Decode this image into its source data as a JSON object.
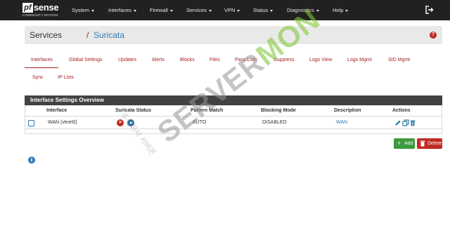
{
  "navbar": {
    "brand": {
      "pf": "pf",
      "sense": "sense",
      "edition": "COMMUNITY EDITION"
    },
    "items": [
      "System",
      "Interfaces",
      "Firewall",
      "Services",
      "VPN",
      "Status",
      "Diagnostics",
      "Help"
    ],
    "logout_icon": "sign-out-icon"
  },
  "breadcrumb": {
    "parent": "Services",
    "separator": "/",
    "current": "Suricata",
    "help_label": "?"
  },
  "tabs": [
    "Interfaces",
    "Global Settings",
    "Updates",
    "Alerts",
    "Blocks",
    "Files",
    "Pass Lists",
    "Suppress",
    "Logs View",
    "Logs Mgmt",
    "SID Mgmt",
    "Sync",
    "IP Lists"
  ],
  "active_tab": "Interfaces",
  "panel": {
    "title": "Interface Settings Overview",
    "columns": [
      "Interface",
      "Suricata Status",
      "Pattern Match",
      "Blocking Mode",
      "Description",
      "Actions"
    ],
    "rows": [
      {
        "interface": "WAN (vtnet0)",
        "pattern_match": "AUTO",
        "blocking_mode": "DISABLED",
        "description": "WAN",
        "status_icons": [
          "stopped-icon",
          "start-icon"
        ],
        "action_icons": [
          "edit-icon",
          "copy-icon",
          "delete-icon"
        ]
      }
    ]
  },
  "buttons": {
    "add": "Add",
    "delete": "Delete"
  },
  "info_label": "i",
  "watermark": {
    "text_gray": "SERVER",
    "text_green": "MON",
    "side_text": "주식회사 서버몬"
  },
  "colors": {
    "navbar": "#212121",
    "accent": "#a61e22",
    "link": "#337ab7",
    "panel_head": "#424242",
    "add": "#3c9a3c",
    "delete": "#c02a20"
  }
}
